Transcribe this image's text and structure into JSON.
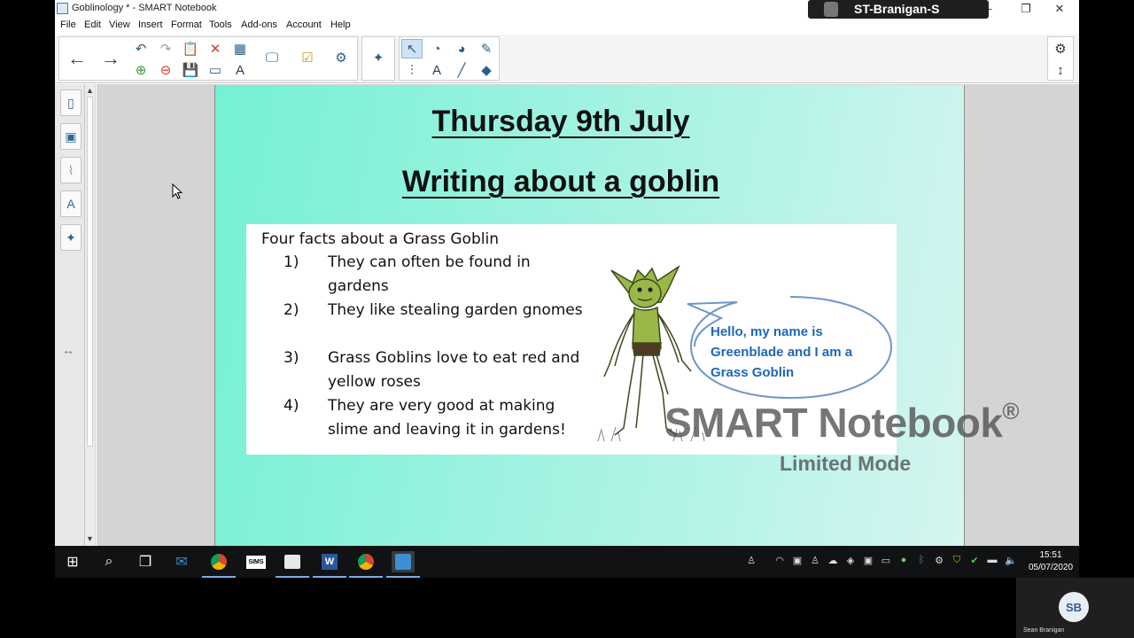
{
  "window": {
    "title": "Goblinology * - SMART Notebook",
    "minimize": "—",
    "restore": "❐",
    "close": "✕"
  },
  "session": {
    "user": "ST-Branigan-S"
  },
  "menu": [
    "File",
    "Edit",
    "View",
    "Insert",
    "Format",
    "Tools",
    "Add-ons",
    "Account",
    "Help"
  ],
  "toolbar_icons": {
    "back": "back-arrow-icon",
    "forward": "forward-arrow-icon",
    "settings": "gear-icon",
    "move": "up-down-arrow-icon"
  },
  "slide": {
    "title": "Thursday 9th July",
    "subtitle": "Writing about a goblin",
    "facts_heading": "Four facts about a Grass Goblin",
    "facts": [
      {
        "num": "1)",
        "text": "They can often be found in gardens"
      },
      {
        "num": "2)",
        "text": "They like stealing garden gnomes"
      },
      {
        "num": "3)",
        "text": "Grass Goblins love to eat red and yellow roses"
      },
      {
        "num": "4)",
        "text": "They are very good at making slime and leaving it in gardens!"
      }
    ],
    "speech_bubble": "Hello, my name is Greenblade and I am a Grass Goblin"
  },
  "watermark": {
    "brand": "SMART Notebook",
    "reg": "®",
    "mode": "Limited Mode"
  },
  "taskbar": {
    "time": "15:51",
    "date": "05/07/2020",
    "sims_label": "SIMS"
  },
  "participant": {
    "initials": "SB",
    "name": "Sean Branigan"
  }
}
